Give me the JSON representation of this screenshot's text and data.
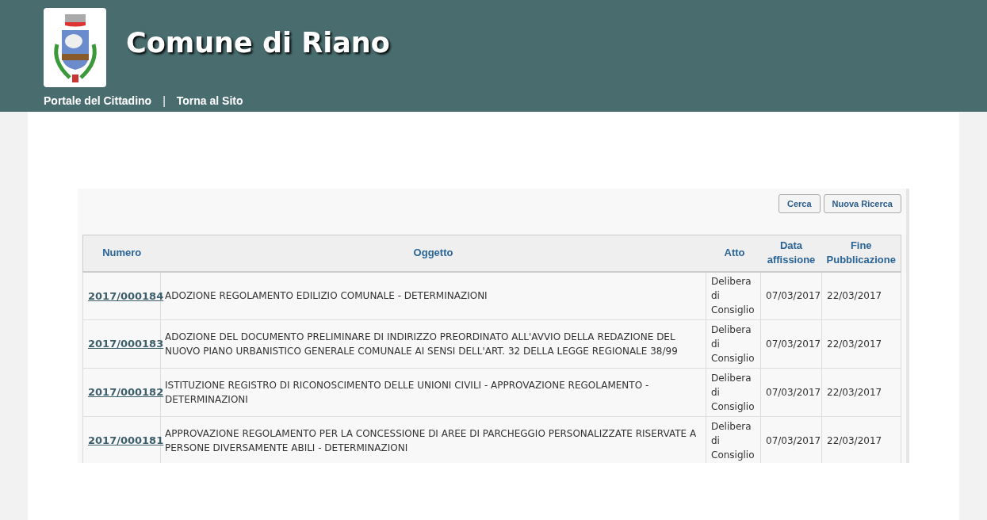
{
  "header": {
    "title": "Comune di Riano",
    "nav": [
      {
        "label": "Portale del Cittadino"
      },
      {
        "label": "Torna al Sito"
      }
    ],
    "separator": "|"
  },
  "buttons": [
    "Cerca",
    "Nuova Ricerca"
  ],
  "table": {
    "columns": [
      "Numero",
      "Oggetto",
      "Atto",
      "Data affissione",
      "Fine Pubblicazione"
    ],
    "rows": [
      {
        "numero": "2017/000184",
        "oggetto": "ADOZIONE REGOLAMENTO EDILIZIO COMUNALE - DETERMINAZIONI",
        "atto": "Delibera di Consiglio",
        "data": "07/03/2017",
        "fine": "22/03/2017"
      },
      {
        "numero": "2017/000183",
        "oggetto": "ADOZIONE DEL DOCUMENTO PRELIMINARE DI INDIRIZZO PREORDINATO ALL'AVVIO DELLA REDAZIONE DEL NUOVO PIANO URBANISTICO GENERALE COMUNALE AI SENSI DELL'ART. 32 DELLA LEGGE REGIONALE 38/99",
        "atto": "Delibera di Consiglio",
        "data": "07/03/2017",
        "fine": "22/03/2017"
      },
      {
        "numero": "2017/000182",
        "oggetto": "ISTITUZIONE REGISTRO DI RICONOSCIMENTO DELLE UNIONI CIVILI - APPROVAZIONE REGOLAMENTO - DETERMINAZIONI",
        "atto": "Delibera di Consiglio",
        "data": "07/03/2017",
        "fine": "22/03/2017"
      },
      {
        "numero": "2017/000181",
        "oggetto": "APPROVAZIONE REGOLAMENTO PER LA CONCESSIONE DI AREE DI PARCHEGGIO PERSONALIZZATE RISERVATE A PERSONE DIVERSAMENTE ABILI - DETERMINAZIONI",
        "atto": "Delibera di Consiglio",
        "data": "07/03/2017",
        "fine": "22/03/2017"
      }
    ]
  }
}
